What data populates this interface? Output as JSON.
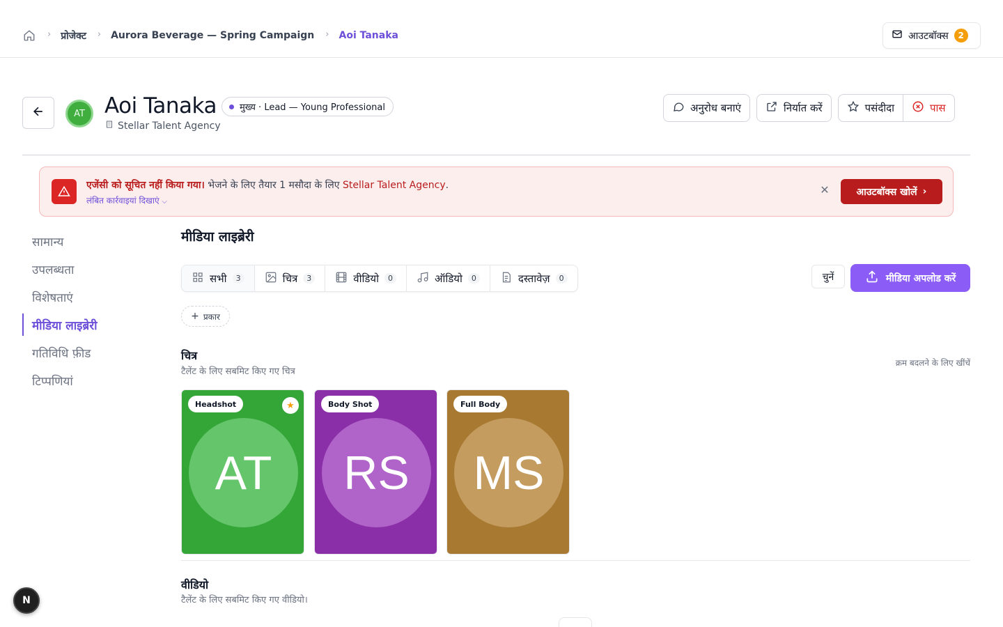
{
  "breadcrumb": {
    "items": [
      "प्रोजेक्ट",
      "Aurora Beverage — Spring Campaign",
      "Aoi Tanaka"
    ]
  },
  "outbox": {
    "label": "आउटबॉक्स",
    "count": "2"
  },
  "talent": {
    "initials": "AT",
    "name": "Aoi Tanaka",
    "role": "मुख्य · Lead — Young Professional",
    "agency": "Stellar Talent Agency"
  },
  "actions": {
    "request": "अनुरोध बनाएं",
    "export": "निर्यात करें",
    "favorite": "पसंदीदा",
    "pass": "पास"
  },
  "alert": {
    "title": "एजेंसी को सूचित नहीं किया गया।",
    "message": " भेजने के लिए तैयार 1 मसौदा के लिए ",
    "agency": "Stellar Talent Agency",
    "period": ".",
    "pending": "लंबित कार्रवाइयां दिखाएं",
    "open_button": "आउटबॉक्स खोलें"
  },
  "nav": {
    "items": [
      {
        "label": "सामान्य"
      },
      {
        "label": "उपलब्धता"
      },
      {
        "label": "विशेषताएं"
      },
      {
        "label": "मीडिया लाइब्रेरी"
      },
      {
        "label": "गतिविधि फ़ीड"
      },
      {
        "label": "टिप्पणियां"
      }
    ]
  },
  "media": {
    "title": "मीडिया लाइब्रेरी",
    "tabs": [
      {
        "label": "सभी",
        "count": "3"
      },
      {
        "label": "चित्र",
        "count": "3"
      },
      {
        "label": "वीडियो",
        "count": "0"
      },
      {
        "label": "ऑडियो",
        "count": "0"
      },
      {
        "label": "दस्तावेज़",
        "count": "0"
      }
    ],
    "choose": "चुनें",
    "upload": "मीडिया अपलोड करें",
    "filter": "प्रकार",
    "images_title": "चित्र",
    "images_sub": "टैलेंट के लिए सबमिट किए गए चित्र",
    "reorder_hint": "क्रम बदलने के लिए खींचें",
    "cards": [
      {
        "tag": "Headshot",
        "initials": "AT",
        "bg": "#33a637",
        "circle": "#64c56a",
        "starred": true
      },
      {
        "tag": "Body Shot",
        "initials": "RS",
        "bg": "#8a2fa8",
        "circle": "#b063c8",
        "starred": false
      },
      {
        "tag": "Full Body",
        "initials": "MS",
        "bg": "#a87a31",
        "circle": "#c49c5f",
        "starred": false
      }
    ],
    "videos_title": "वीडियो",
    "videos_sub": "टैलेंट के लिए सबमिट किए गए वीडियो।"
  },
  "colors": {
    "accent": "#6d4fd9",
    "danger": "#b91c1c",
    "upload": "#8b5cf6"
  },
  "dev_badge": "N"
}
